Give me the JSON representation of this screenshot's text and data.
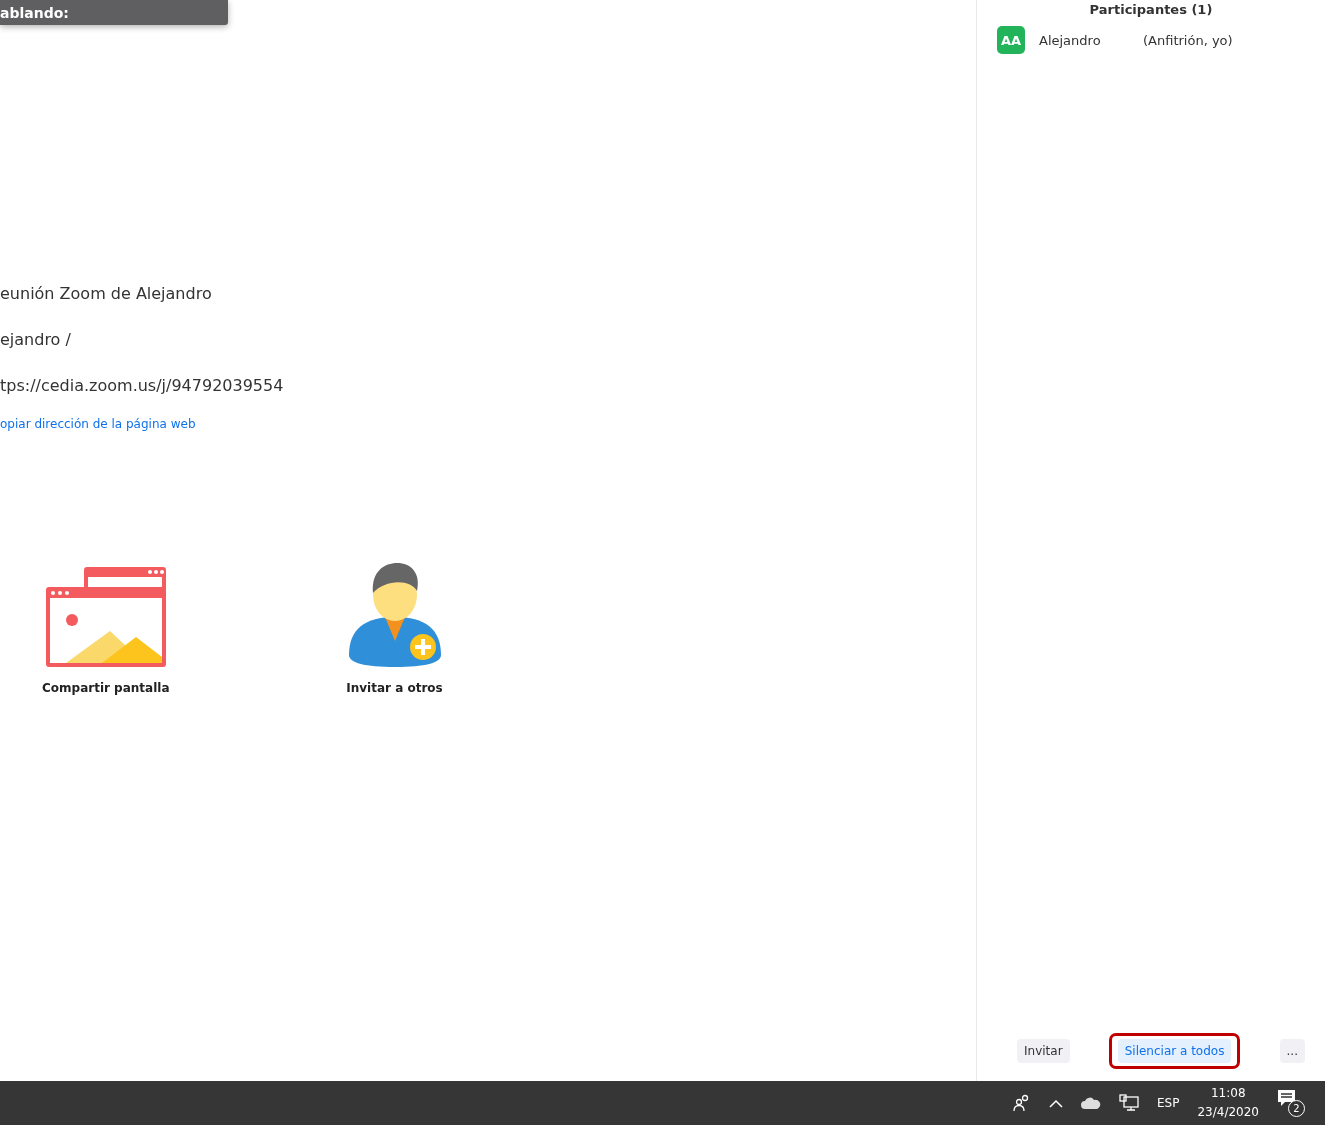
{
  "speaking_banner": {
    "label": "ablando:"
  },
  "meeting_info": {
    "topic": "eunión Zoom de Alejandro",
    "host": "ejandro /",
    "url": "tps://cedia.zoom.us/j/94792039554",
    "copy_link": "opiar dirección de la página web"
  },
  "actions": [
    {
      "kind": "share",
      "label": "Compartir pantalla"
    },
    {
      "kind": "invite",
      "label": "Invitar a otros"
    }
  ],
  "participants_panel": {
    "title": "Participantes (1)",
    "participants": [
      {
        "initials": "AA",
        "name": "Alejandro",
        "role": "(Anfitrión, yo)",
        "color": "#23b35a"
      }
    ],
    "buttons": [
      {
        "label": "Invitar",
        "highlighted": false
      },
      {
        "label": "Silenciar a todos",
        "highlighted": true
      },
      {
        "label": "...",
        "highlighted": false
      }
    ]
  },
  "taskbar": {
    "language": "ESP",
    "time": "11:08",
    "date": "23/4/2020",
    "notification_count": "2"
  }
}
